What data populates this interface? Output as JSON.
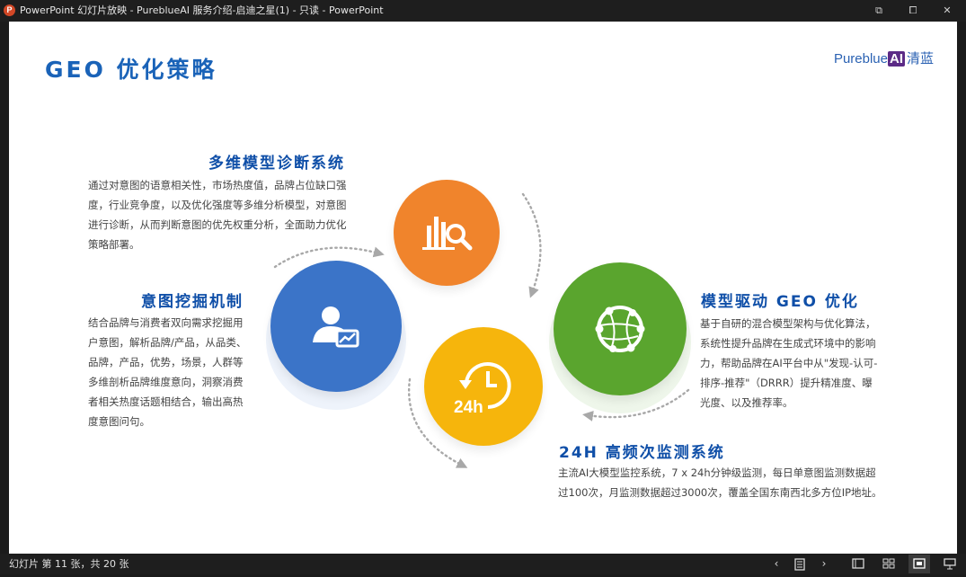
{
  "window": {
    "title": "PowerPoint 幻灯片放映  -  PureblueAI 服务介绍-启迪之星(1)  -  只读 - PowerPoint",
    "app_icon_letter": "P",
    "controls": {
      "restore_down": "⧉",
      "maximize": "⧠",
      "close": "✕"
    }
  },
  "slide": {
    "title": "GEO 优化策略",
    "brand": {
      "prefix": "Pureblue",
      "ai": "AI",
      "cn": "清蓝"
    },
    "sections": {
      "diagnosis": {
        "title": "多维模型诊断系统",
        "lines": [
          "通过对意图的语意相关性，市场热度值，品牌占位缺口强",
          "度，行业竞争度，以及优化强度等多维分析模型，对意图",
          "进行诊断，从而判断意图的优先权重分析，全面助力优化",
          "策略部署。"
        ]
      },
      "intent": {
        "title": "意图挖掘机制",
        "lines": [
          "结合品牌与消费者双向需求挖掘用",
          "户意图，解析品牌/产品，从品类、",
          "品牌，产品，优势，场景，人群等",
          "多维剖析品牌维度意向，洞察消费",
          "者相关热度话题相结合，输出高热",
          "度意图问句。"
        ]
      },
      "model": {
        "title": "模型驱动 GEO 优化",
        "lines": [
          "基于自研的混合模型架构与优化算法，",
          "系统性提升品牌在生成式环境中的影响",
          "力，帮助品牌在AI平台中从\"发现-认可-",
          "排序-推荐\"（DRRR）提升精准度、曝",
          "光度、以及推荐率。"
        ]
      },
      "monitor": {
        "title": "24H 高频次监测系统",
        "lines": [
          "主流AI大模型监控系统，7 x 24h分钟级监测，每日单意图监测数据超",
          "过100次，月监测数据超过3000次，覆盖全国东南西北多方位IP地址。"
        ]
      }
    },
    "icons": {
      "orange": "bar-chart-search-icon",
      "blue": "user-chart-icon",
      "green": "network-globe-icon",
      "yellow": "clock-24h-icon",
      "clock_label": "24h"
    },
    "colors": {
      "orange": "#f0842c",
      "blue": "#3b74c8",
      "green": "#5aa52e",
      "yellow": "#f6b50c",
      "title_blue": "#1a63b8"
    }
  },
  "statusbar": {
    "slide_count": "幻灯片 第 11 张，共 20 张",
    "prev": "‹",
    "next": "›"
  }
}
